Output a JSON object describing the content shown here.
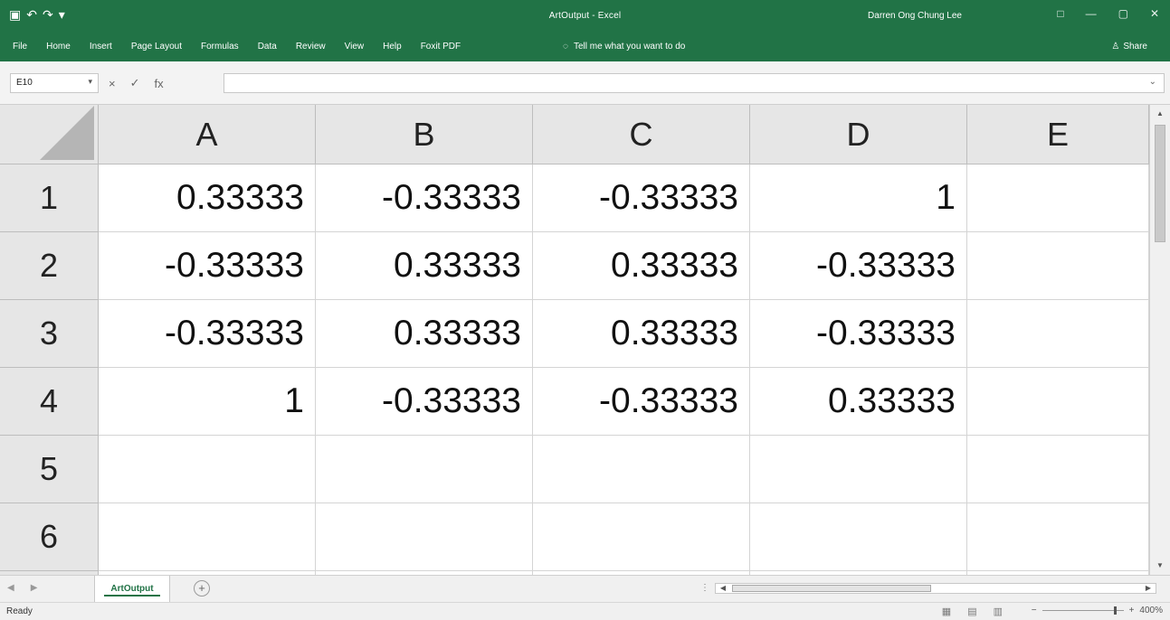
{
  "window": {
    "title": "ArtOutput - Excel",
    "user": "Darren Ong Chung Lee",
    "share": "Share"
  },
  "ribbon": {
    "tabs": [
      "File",
      "Home",
      "Insert",
      "Page Layout",
      "Formulas",
      "Data",
      "Review",
      "View",
      "Help",
      "Foxit PDF"
    ],
    "tell_me": "Tell me what you want to do"
  },
  "formula_bar": {
    "name_box": "E10",
    "fx": "fx"
  },
  "sheet": {
    "columns": [
      "A",
      "B",
      "C",
      "D",
      "E"
    ],
    "rows": [
      {
        "label": "1",
        "cells": [
          "0.33333",
          "-0.33333",
          "-0.33333",
          "1",
          ""
        ]
      },
      {
        "label": "2",
        "cells": [
          "-0.33333",
          "0.33333",
          "0.33333",
          "-0.33333",
          ""
        ]
      },
      {
        "label": "3",
        "cells": [
          "-0.33333",
          "0.33333",
          "0.33333",
          "-0.33333",
          ""
        ]
      },
      {
        "label": "4",
        "cells": [
          "1",
          "-0.33333",
          "-0.33333",
          "0.33333",
          ""
        ]
      },
      {
        "label": "5",
        "cells": [
          "",
          "",
          "",
          "",
          ""
        ]
      },
      {
        "label": "6",
        "cells": [
          "",
          "",
          "",
          "",
          ""
        ]
      }
    ],
    "active_tab": "ArtOutput"
  },
  "status": {
    "ready": "Ready",
    "zoom": "400%"
  },
  "colors": {
    "accent": "#217346"
  }
}
